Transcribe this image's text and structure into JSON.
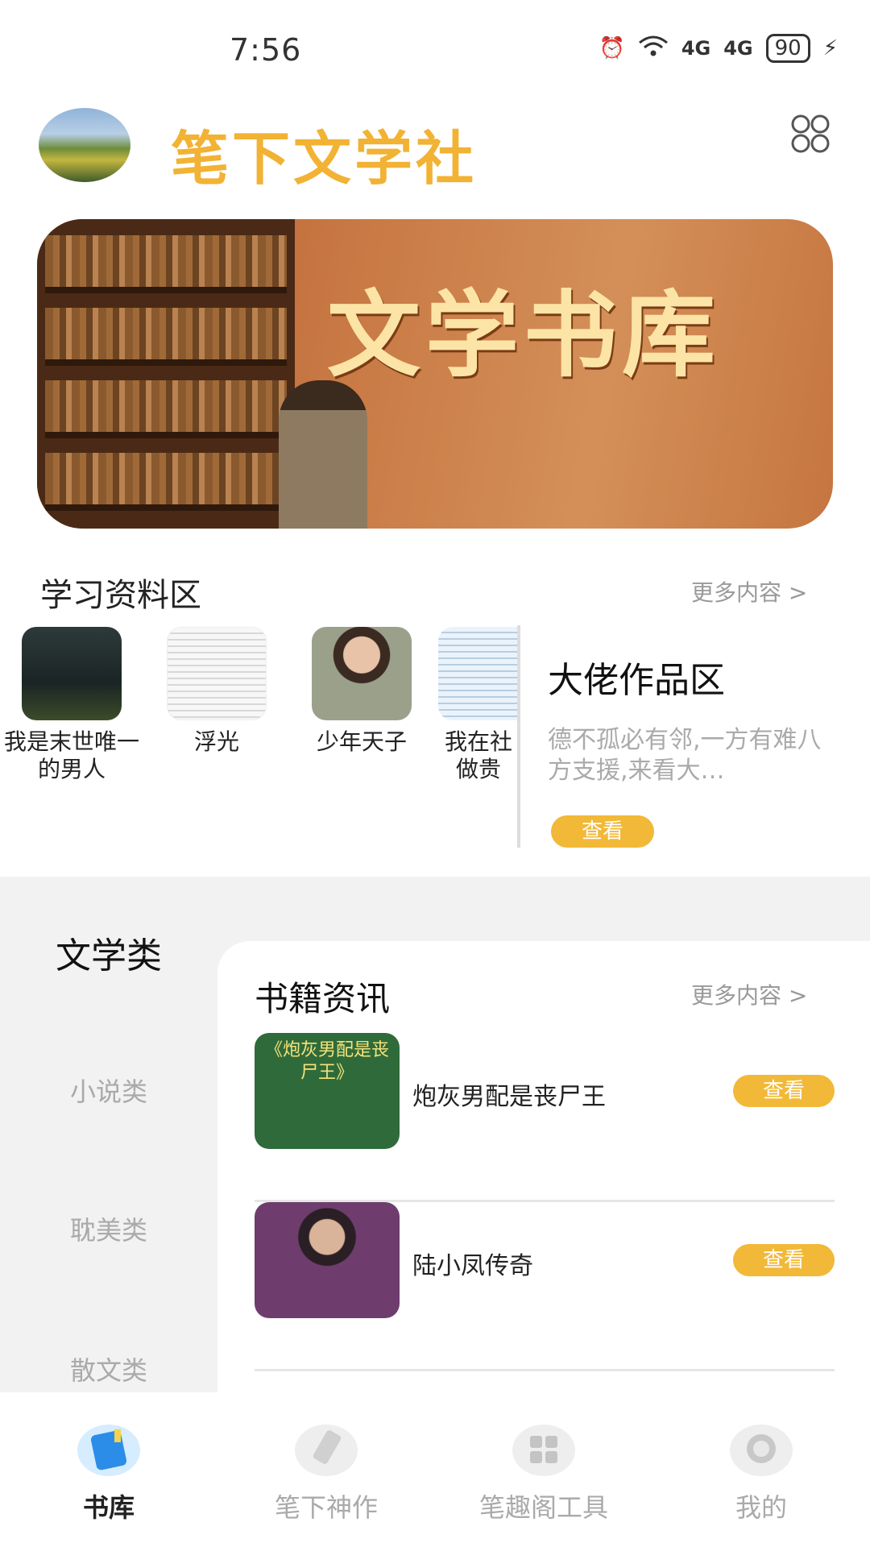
{
  "status_bar": {
    "time": "7:56",
    "signal_1": "4G",
    "signal_2": "4G",
    "battery": "90"
  },
  "header": {
    "app_title": "笔下文学社"
  },
  "banner": {
    "title": "文学书库"
  },
  "study": {
    "title": "学习资料区",
    "more": "更多内容 >",
    "books": [
      {
        "name": "我是末世唯一的男人"
      },
      {
        "name": "浮光"
      },
      {
        "name": "少年天子"
      },
      {
        "name": "我在社做贵"
      }
    ]
  },
  "author_zone": {
    "title": "大佬作品区",
    "desc": "德不孤必有邻,一方有难八方支援,来看大…",
    "button": "查看"
  },
  "categories": [
    {
      "label": "文学类",
      "active": true
    },
    {
      "label": "小说类",
      "active": false
    },
    {
      "label": "耽美类",
      "active": false
    },
    {
      "label": "散文类",
      "active": false
    }
  ],
  "news": {
    "title": "书籍资讯",
    "more": "更多内容 >",
    "items": [
      {
        "name": "炮灰男配是丧尸王",
        "button": "查看",
        "cover_text": "《炮灰男配是丧尸王》"
      },
      {
        "name": "陆小凤传奇",
        "button": "查看"
      }
    ]
  },
  "bottom_nav": {
    "items": [
      {
        "label": "书库",
        "active": true
      },
      {
        "label": "笔下神作",
        "active": false
      },
      {
        "label": "笔趣阁工具",
        "active": false
      },
      {
        "label": "我的",
        "active": false
      }
    ]
  },
  "colors": {
    "accent": "#f2b233",
    "button": "#f2b837"
  }
}
